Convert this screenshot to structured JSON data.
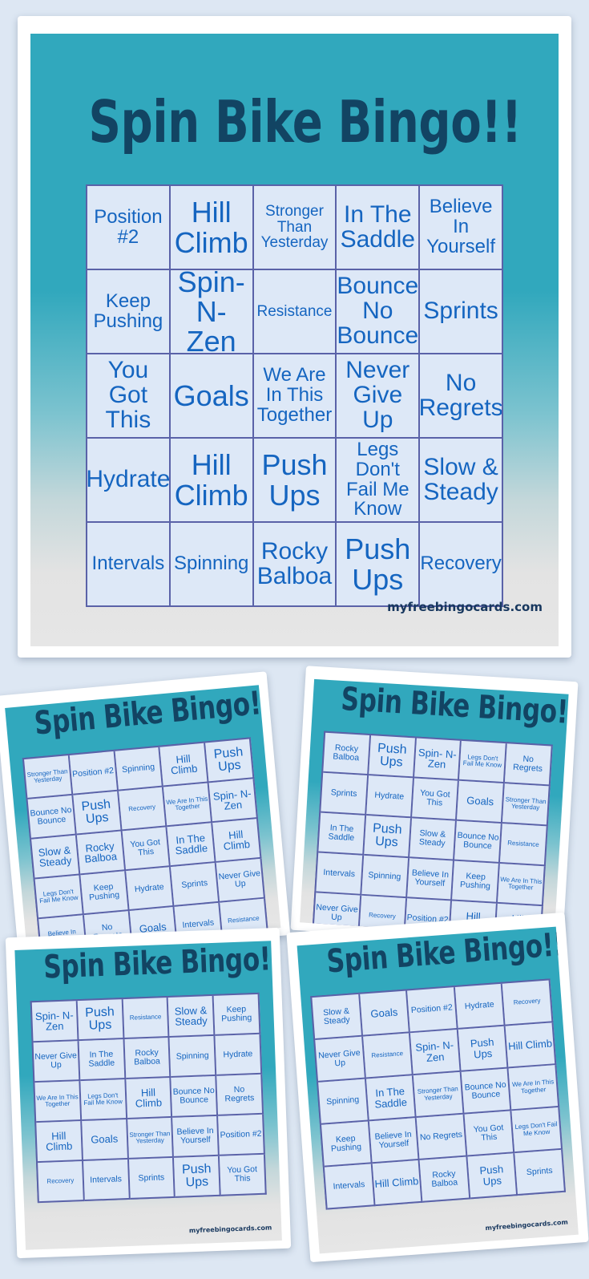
{
  "page": {
    "background_color": "#dde7f3",
    "card_frame_color": "#ffffff",
    "teal_color": "#31a8bd",
    "title_color": "#124463",
    "cell_fill_color": "#dde8f7",
    "cell_border_color": "#5a62a8",
    "cell_text_color": "#1565c0",
    "brand_color": "#17375e"
  },
  "main_card": {
    "title": "Spin Bike Bingo!!",
    "brand": "myfreebingocards.com",
    "grid": {
      "rows": 5,
      "columns": 5,
      "cells": [
        [
          {
            "text": "Position #2",
            "size": "t-md"
          },
          {
            "text": "Hill Climb",
            "size": "t-xl"
          },
          {
            "text": "Stronger Than Yesterday",
            "size": "t-sm"
          },
          {
            "text": "In The Saddle",
            "size": "t-lg"
          },
          {
            "text": "Believe In Yourself",
            "size": "t-md"
          }
        ],
        [
          {
            "text": "Keep Pushing",
            "size": "t-md"
          },
          {
            "text": "Spin- N-Zen",
            "size": "t-xl"
          },
          {
            "text": "Resistance",
            "size": "t-sm"
          },
          {
            "text": "Bounce No Bounce",
            "size": "t-lg"
          },
          {
            "text": "Sprints",
            "size": "t-lg"
          }
        ],
        [
          {
            "text": "You Got This",
            "size": "t-lg"
          },
          {
            "text": "Goals",
            "size": "t-xl"
          },
          {
            "text": "We Are In This Together",
            "size": "t-md"
          },
          {
            "text": "Never Give Up",
            "size": "t-lg"
          },
          {
            "text": "No Regrets",
            "size": "t-lg"
          }
        ],
        [
          {
            "text": "Hydrate",
            "size": "t-lg"
          },
          {
            "text": "Hill Climb",
            "size": "t-xl"
          },
          {
            "text": "Push Ups",
            "size": "t-xl"
          },
          {
            "text": "Legs Don't Fail Me Know",
            "size": "t-md"
          },
          {
            "text": "Slow & Steady",
            "size": "t-lg"
          }
        ],
        [
          {
            "text": "Intervals",
            "size": "t-md"
          },
          {
            "text": "Spinning",
            "size": "t-md"
          },
          {
            "text": "Rocky Balboa",
            "size": "t-lg"
          },
          {
            "text": "Push Ups",
            "size": "t-xl"
          },
          {
            "text": "Recovery",
            "size": "t-md"
          }
        ]
      ]
    }
  },
  "thumbnails": [
    {
      "id": "thumb-1",
      "title": "Spin Bike Bingo!!",
      "grid": {
        "cells": [
          [
            {
              "text": "Stronger Than Yesterday",
              "size": "t-xs"
            },
            {
              "text": "Position #2",
              "size": "t-sm"
            },
            {
              "text": "Spinning",
              "size": "t-sm"
            },
            {
              "text": "Hill Climb",
              "size": "t-md"
            },
            {
              "text": "Push Ups",
              "size": "t-lg"
            }
          ],
          [
            {
              "text": "Bounce No Bounce",
              "size": "t-sm"
            },
            {
              "text": "Push Ups",
              "size": "t-lg"
            },
            {
              "text": "Recovery",
              "size": "t-xs"
            },
            {
              "text": "We Are In This Together",
              "size": "t-xs"
            },
            {
              "text": "Spin- N-Zen",
              "size": "t-md"
            }
          ],
          [
            {
              "text": "Slow & Steady",
              "size": "t-md"
            },
            {
              "text": "Rocky Balboa",
              "size": "t-md"
            },
            {
              "text": "You Got This",
              "size": "t-sm"
            },
            {
              "text": "In The Saddle",
              "size": "t-md"
            },
            {
              "text": "Hill Climb",
              "size": "t-md"
            }
          ],
          [
            {
              "text": "Legs Don't Fail Me Know",
              "size": "t-xs"
            },
            {
              "text": "Keep Pushing",
              "size": "t-sm"
            },
            {
              "text": "Hydrate",
              "size": "t-sm"
            },
            {
              "text": "Sprints",
              "size": "t-sm"
            },
            {
              "text": "Never Give Up",
              "size": "t-sm"
            }
          ],
          [
            {
              "text": "Believe In Yourself",
              "size": "t-xs"
            },
            {
              "text": "No Regrets",
              "size": "t-sm"
            },
            {
              "text": "Goals",
              "size": "t-md"
            },
            {
              "text": "Intervals",
              "size": "t-sm"
            },
            {
              "text": "Resistance",
              "size": "t-xs"
            }
          ]
        ]
      }
    },
    {
      "id": "thumb-2",
      "title": "Spin Bike Bingo!!",
      "grid": {
        "cells": [
          [
            {
              "text": "Rocky Balboa",
              "size": "t-sm"
            },
            {
              "text": "Push Ups",
              "size": "t-lg"
            },
            {
              "text": "Spin- N-Zen",
              "size": "t-md"
            },
            {
              "text": "Legs Don't Fail Me Know",
              "size": "t-xs"
            },
            {
              "text": "No Regrets",
              "size": "t-sm"
            }
          ],
          [
            {
              "text": "Sprints",
              "size": "t-sm"
            },
            {
              "text": "Hydrate",
              "size": "t-sm"
            },
            {
              "text": "You Got This",
              "size": "t-sm"
            },
            {
              "text": "Goals",
              "size": "t-md"
            },
            {
              "text": "Stronger Than Yesterday",
              "size": "t-xs"
            }
          ],
          [
            {
              "text": "In The Saddle",
              "size": "t-sm"
            },
            {
              "text": "Push Ups",
              "size": "t-lg"
            },
            {
              "text": "Slow & Steady",
              "size": "t-sm"
            },
            {
              "text": "Bounce No Bounce",
              "size": "t-sm"
            },
            {
              "text": "Resistance",
              "size": "t-xs"
            }
          ],
          [
            {
              "text": "Intervals",
              "size": "t-sm"
            },
            {
              "text": "Spinning",
              "size": "t-sm"
            },
            {
              "text": "Believe In Yourself",
              "size": "t-sm"
            },
            {
              "text": "Keep Pushing",
              "size": "t-sm"
            },
            {
              "text": "We Are In This Together",
              "size": "t-xs"
            }
          ],
          [
            {
              "text": "Never Give Up",
              "size": "t-sm"
            },
            {
              "text": "Recovery",
              "size": "t-xs"
            },
            {
              "text": "Position #2",
              "size": "t-sm"
            },
            {
              "text": "Hill Climb",
              "size": "t-md"
            },
            {
              "text": "Hill Climb",
              "size": "t-md"
            }
          ]
        ]
      }
    },
    {
      "id": "thumb-3",
      "title": "Spin Bike Bingo!!",
      "brand": "myfreebingocards.com",
      "grid": {
        "cells": [
          [
            {
              "text": "Spin- N-Zen",
              "size": "t-md"
            },
            {
              "text": "Push Ups",
              "size": "t-lg"
            },
            {
              "text": "Resistance",
              "size": "t-xs"
            },
            {
              "text": "Slow & Steady",
              "size": "t-md"
            },
            {
              "text": "Keep Pushing",
              "size": "t-sm"
            }
          ],
          [
            {
              "text": "Never Give Up",
              "size": "t-sm"
            },
            {
              "text": "In The Saddle",
              "size": "t-sm"
            },
            {
              "text": "Rocky Balboa",
              "size": "t-sm"
            },
            {
              "text": "Spinning",
              "size": "t-sm"
            },
            {
              "text": "Hydrate",
              "size": "t-sm"
            }
          ],
          [
            {
              "text": "We Are In This Together",
              "size": "t-xs"
            },
            {
              "text": "Legs Don't Fail Me Know",
              "size": "t-xs"
            },
            {
              "text": "Hill Climb",
              "size": "t-md"
            },
            {
              "text": "Bounce No Bounce",
              "size": "t-sm"
            },
            {
              "text": "No Regrets",
              "size": "t-sm"
            }
          ],
          [
            {
              "text": "Hill Climb",
              "size": "t-md"
            },
            {
              "text": "Goals",
              "size": "t-md"
            },
            {
              "text": "Stronger Than Yesterday",
              "size": "t-xs"
            },
            {
              "text": "Believe In Yourself",
              "size": "t-sm"
            },
            {
              "text": "Position #2",
              "size": "t-sm"
            }
          ],
          [
            {
              "text": "Recovery",
              "size": "t-xs"
            },
            {
              "text": "Intervals",
              "size": "t-sm"
            },
            {
              "text": "Sprints",
              "size": "t-sm"
            },
            {
              "text": "Push Ups",
              "size": "t-lg"
            },
            {
              "text": "You Got This",
              "size": "t-sm"
            }
          ]
        ]
      }
    },
    {
      "id": "thumb-4",
      "title": "Spin Bike Bingo!!",
      "brand": "myfreebingocards.com",
      "grid": {
        "cells": [
          [
            {
              "text": "Slow & Steady",
              "size": "t-sm"
            },
            {
              "text": "Goals",
              "size": "t-md"
            },
            {
              "text": "Position #2",
              "size": "t-sm"
            },
            {
              "text": "Hydrate",
              "size": "t-sm"
            },
            {
              "text": "Recovery",
              "size": "t-xs"
            }
          ],
          [
            {
              "text": "Never Give Up",
              "size": "t-sm"
            },
            {
              "text": "Resistance",
              "size": "t-xs"
            },
            {
              "text": "Spin- N-Zen",
              "size": "t-md"
            },
            {
              "text": "Push Ups",
              "size": "t-md"
            },
            {
              "text": "Hill Climb",
              "size": "t-md"
            }
          ],
          [
            {
              "text": "Spinning",
              "size": "t-sm"
            },
            {
              "text": "In The Saddle",
              "size": "t-md"
            },
            {
              "text": "Stronger Than Yesterday",
              "size": "t-xs"
            },
            {
              "text": "Bounce No Bounce",
              "size": "t-sm"
            },
            {
              "text": "We Are In This Together",
              "size": "t-xs"
            }
          ],
          [
            {
              "text": "Keep Pushing",
              "size": "t-sm"
            },
            {
              "text": "Believe In Yourself",
              "size": "t-sm"
            },
            {
              "text": "No Regrets",
              "size": "t-sm"
            },
            {
              "text": "You Got This",
              "size": "t-sm"
            },
            {
              "text": "Legs Don't Fail Me Know",
              "size": "t-xs"
            }
          ],
          [
            {
              "text": "Intervals",
              "size": "t-sm"
            },
            {
              "text": "Hill Climb",
              "size": "t-md"
            },
            {
              "text": "Rocky Balboa",
              "size": "t-sm"
            },
            {
              "text": "Push Ups",
              "size": "t-md"
            },
            {
              "text": "Sprints",
              "size": "t-sm"
            }
          ]
        ]
      }
    }
  ]
}
